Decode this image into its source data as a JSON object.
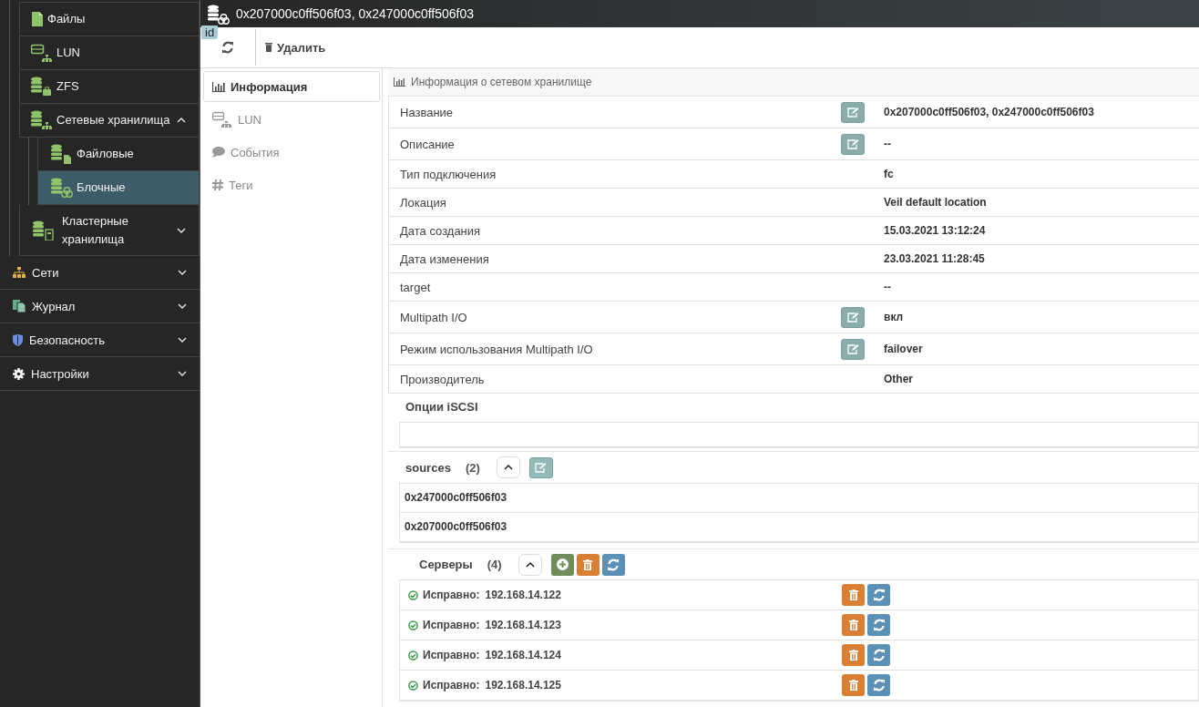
{
  "sidebar": {
    "tree_items": [
      {
        "label": "Файлы",
        "selected": false
      },
      {
        "label": "LUN",
        "selected": false
      },
      {
        "label": "ZFS",
        "selected": false
      },
      {
        "label": "Сетевые хранилища",
        "expanded": true,
        "selected": false,
        "children": [
          {
            "label": "Файловые",
            "selected": false
          },
          {
            "label": "Блочные",
            "selected": true
          }
        ]
      },
      {
        "label": "Кластерные хранилища",
        "expanded": false,
        "selected": false
      }
    ],
    "sections": [
      {
        "label": "Сети",
        "expanded": false
      },
      {
        "label": "Журнал",
        "expanded": false
      },
      {
        "label": "Безопасность",
        "expanded": false
      },
      {
        "label": "Настройки",
        "expanded": false
      }
    ]
  },
  "header": {
    "title": "0x207000c0ff506f03, 0x247000c0ff506f03",
    "badge": "id"
  },
  "toolbar": {
    "buttons": [
      {
        "label": "Удалить"
      }
    ]
  },
  "tabs": [
    {
      "label": "Информация",
      "selected": true
    },
    {
      "label": "LUN",
      "selected": false
    },
    {
      "label": "События",
      "selected": false
    },
    {
      "label": "Теги",
      "selected": false
    }
  ],
  "panel": {
    "title": "Информация о сетевом хранилище",
    "rows": [
      {
        "label": "Название",
        "editable": true,
        "value": "0x207000c0ff506f03, 0x247000c0ff506f03"
      },
      {
        "label": "Описание",
        "editable": true,
        "value": "--"
      },
      {
        "label": "Тип подключения",
        "editable": false,
        "value": "fc"
      },
      {
        "label": "Локация",
        "editable": false,
        "value": "Veil default location"
      },
      {
        "label": "Дата создания",
        "editable": false,
        "value": "15.03.2021 13:12:24"
      },
      {
        "label": "Дата изменения",
        "editable": false,
        "value": "23.03.2021 11:28:45"
      },
      {
        "label": "target",
        "editable": false,
        "value": "--"
      },
      {
        "label": "Multipath I/O",
        "editable": true,
        "value": "вкл"
      },
      {
        "label": "Режим использования Multipath I/O",
        "editable": true,
        "value": "failover"
      },
      {
        "label": "Производитель",
        "editable": false,
        "value": "Other"
      }
    ],
    "iscsi": {
      "title": "Опции iSCSI"
    },
    "sources": {
      "title": "sources",
      "count": "(2)",
      "expanded": true,
      "items": [
        "0x247000c0ff506f03",
        "0x207000c0ff506f03"
      ]
    },
    "servers": {
      "title": "Серверы",
      "count": "(4)",
      "expanded": true,
      "items": [
        {
          "status": "Исправно:",
          "ok": true,
          "address": "192.168.14.122"
        },
        {
          "status": "Исправно:",
          "ok": true,
          "address": "192.168.14.123"
        },
        {
          "status": "Исправно:",
          "ok": true,
          "address": "192.168.14.124"
        },
        {
          "status": "Исправно:",
          "ok": true,
          "address": "192.168.14.125"
        }
      ]
    }
  }
}
